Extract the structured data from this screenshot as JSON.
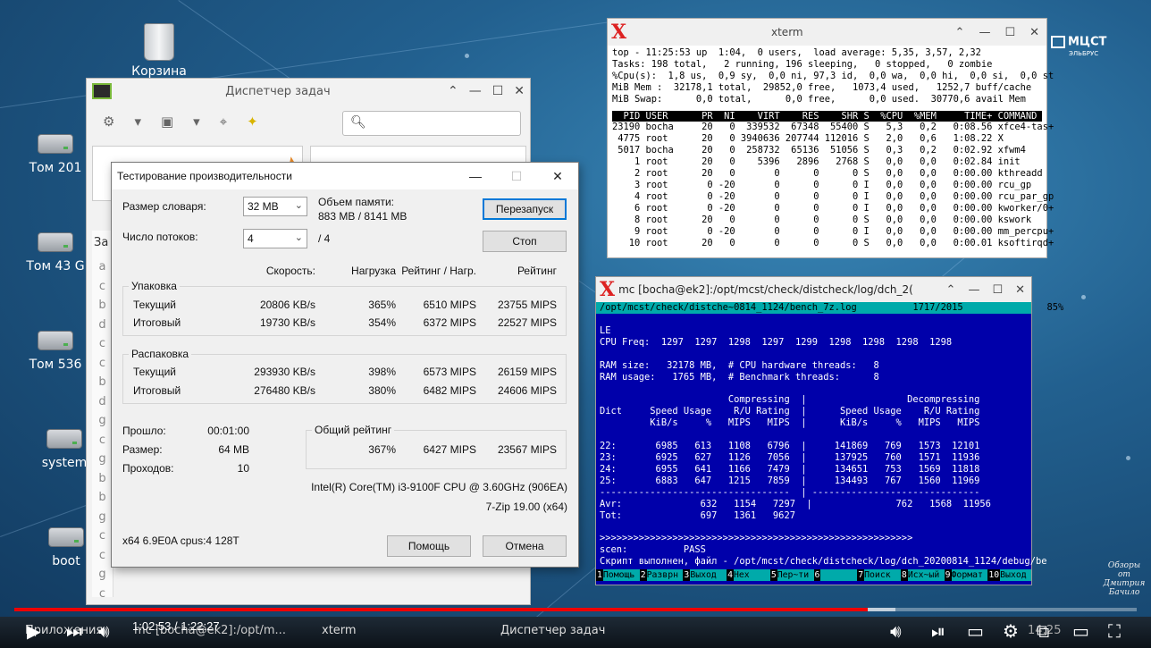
{
  "desktop": {
    "icons": [
      {
        "label": "Корзина"
      },
      {
        "label": "Том 201"
      },
      {
        "label": "Том 43 G"
      },
      {
        "label": "Том 536"
      },
      {
        "label": "system"
      },
      {
        "label": "boot"
      }
    ],
    "logo": {
      "main": "МЦСТ",
      "sub": "ЭЛЬБРУС"
    }
  },
  "taskmgr": {
    "title": "Диспетчер задач",
    "side_label": "За",
    "side_letters": [
      "a",
      "c",
      "b",
      "d",
      "c",
      "c",
      "b",
      "d",
      "g",
      "c",
      "g",
      "b",
      "b",
      "g",
      "c",
      "c",
      "g",
      "c"
    ]
  },
  "bench": {
    "title": "Тестирование производительности",
    "dict_label": "Размер словаря:",
    "dict_value": "32 MB",
    "threads_label": "Число потоков:",
    "threads_value": "4",
    "threads_max": "/ 4",
    "memory_label": "Объем памяти:",
    "memory_value": "883 MB / 8141 MB",
    "restart_button": "Перезапуск",
    "stop_button": "Стоп",
    "col_speed": "Скорость:",
    "col_load": "Нагрузка",
    "col_rating_load": "Рейтинг / Нагр.",
    "col_rating": "Рейтинг",
    "compress": {
      "caption": "Упаковка",
      "rows": [
        {
          "label": "Текущий",
          "speed": "20806 KB/s",
          "load": "365%",
          "rating_load": "6510 MIPS",
          "rating": "23755 MIPS"
        },
        {
          "label": "Итоговый",
          "speed": "19730 KB/s",
          "load": "354%",
          "rating_load": "6372 MIPS",
          "rating": "22527 MIPS"
        }
      ]
    },
    "decompress": {
      "caption": "Распаковка",
      "rows": [
        {
          "label": "Текущий",
          "speed": "293930 KB/s",
          "load": "398%",
          "rating_load": "6573 MIPS",
          "rating": "26159 MIPS"
        },
        {
          "label": "Итоговый",
          "speed": "276480 KB/s",
          "load": "380%",
          "rating_load": "6482 MIPS",
          "rating": "24606 MIPS"
        }
      ]
    },
    "elapsed_label": "Прошло:",
    "elapsed_value": "00:01:00",
    "size_label": "Размер:",
    "size_value": "64 MB",
    "passes_label": "Проходов:",
    "passes_value": "10",
    "total": {
      "caption": "Общий рейтинг",
      "load": "367%",
      "rating_load": "6427 MIPS",
      "rating": "23567 MIPS"
    },
    "cpu": "Intel(R) Core(TM) i3-9100F CPU @ 3.60GHz (906EA)",
    "version": "7-Zip 19.00 (x64)",
    "sysinfo": "x64 6.9E0A cpus:4 128T",
    "help_button": "Помощь",
    "cancel_button": "Отмена"
  },
  "xterm": {
    "title": "xterm",
    "summary": "top - 11:25:53 up  1:04,  0 users,  load average: 5,35, 3,57, 2,32\nTasks: 198 total,   2 running, 196 sleeping,   0 stopped,   0 zombie\n%Cpu(s):  1,8 us,  0,9 sy,  0,0 ni, 97,3 id,  0,0 wa,  0,0 hi,  0,0 si,  0,0 st\nMiB Mem :  32178,1 total,  29852,0 free,   1073,4 used,   1252,7 buff/cache\nMiB Swap:      0,0 total,      0,0 free,      0,0 used.  30770,6 avail Mem",
    "header": "  PID USER      PR  NI    VIRT    RES    SHR S  %CPU  %MEM     TIME+ COMMAND     ",
    "processes": "23190 bocha     20   0  339532  67348  55400 S   5,3   0,2   0:08.56 xfce4-tas+\n 4775 root      20   0 3940636 207744 112016 S   2,0   0,6   1:08.22 X\n 5017 bocha     20   0  258732  65136  51056 S   0,3   0,2   0:02.92 xfwm4\n    1 root      20   0    5396   2896   2768 S   0,0   0,0   0:02.84 init\n    2 root      20   0       0      0      0 S   0,0   0,0   0:00.00 kthreadd\n    3 root       0 -20       0      0      0 I   0,0   0,0   0:00.00 rcu_gp\n    4 root       0 -20       0      0      0 I   0,0   0,0   0:00.00 rcu_par_gp\n    6 root       0 -20       0      0      0 I   0,0   0,0   0:00.00 kworker/0+\n    8 root      20   0       0      0      0 S   0,0   0,0   0:00.00 kswork\n    9 root       0 -20       0      0      0 I   0,0   0,0   0:00.00 mm_percpu+\n   10 root      20   0       0      0      0 S   0,0   0,0   0:00.01 ksoftirqd+"
  },
  "mc": {
    "title": "mc [bocha@ek2]:/opt/mcst/check/distcheck/log/dch_2(",
    "path_bar": "/opt/mcst/check/distche~0814_1124/bench_7z.log          1717/2015               85%",
    "body": "LE\nCPU Freq:  1297  1297  1298  1297  1299  1298  1298  1298  1298\n\nRAM size:   32178 MB,  # CPU hardware threads:   8\nRAM usage:   1765 MB,  # Benchmark threads:      8\n\n                       Compressing  |                  Decompressing\nDict     Speed Usage    R/U Rating  |      Speed Usage    R/U Rating\n         KiB/s     %   MIPS   MIPS  |      KiB/s     %   MIPS   MIPS\n\n22:       6985   613   1108   6796  |     141869   769   1573  12101\n23:       6925   627   1126   7056  |     137925   760   1571  11936\n24:       6955   641   1166   7479  |     134651   753   1569  11818\n25:       6883   647   1215   7859  |     134493   767   1560  11969\n----------------------------------  | ------------------------------\nAvr:              632   1154   7297  |               762   1568  11956\nTot:              697   1361   9627\n\n>>>>>>>>>>>>>>>>>>>>>>>>>>>>>>>>>>>>>>>>>>>>>>>>>>>>>>>>\nscen:          PASS\nСкрипт выполнен, файл - /opt/mcst/check/distcheck/log/dch_20200814_1124/debug/be",
    "fkeys": [
      {
        "n": "1",
        "l": "Помощь"
      },
      {
        "n": "2",
        "l": "Разврн"
      },
      {
        "n": "3",
        "l": "Выход"
      },
      {
        "n": "4",
        "l": "Hex"
      },
      {
        "n": "5",
        "l": "Пер~ти"
      },
      {
        "n": "6",
        "l": ""
      },
      {
        "n": "7",
        "l": "Поиск"
      },
      {
        "n": "8",
        "l": "Исх~ый"
      },
      {
        "n": "9",
        "l": "Формат"
      },
      {
        "n": "10",
        "l": "Выход"
      }
    ]
  },
  "player": {
    "time": "1:02:53 / 1:22:27",
    "progress": 0.76,
    "buffered": 0.785,
    "watermark": "Обзоры\nот\nДмитрия\nБачило"
  },
  "taskbar": {
    "items": [
      {
        "label": "Приложения"
      },
      {
        "label": "mc [bocha@ek2]:/opt/m..."
      },
      {
        "label": "xterm"
      },
      {
        "label": "Диспетчер задач"
      }
    ],
    "clock": "14:25"
  }
}
